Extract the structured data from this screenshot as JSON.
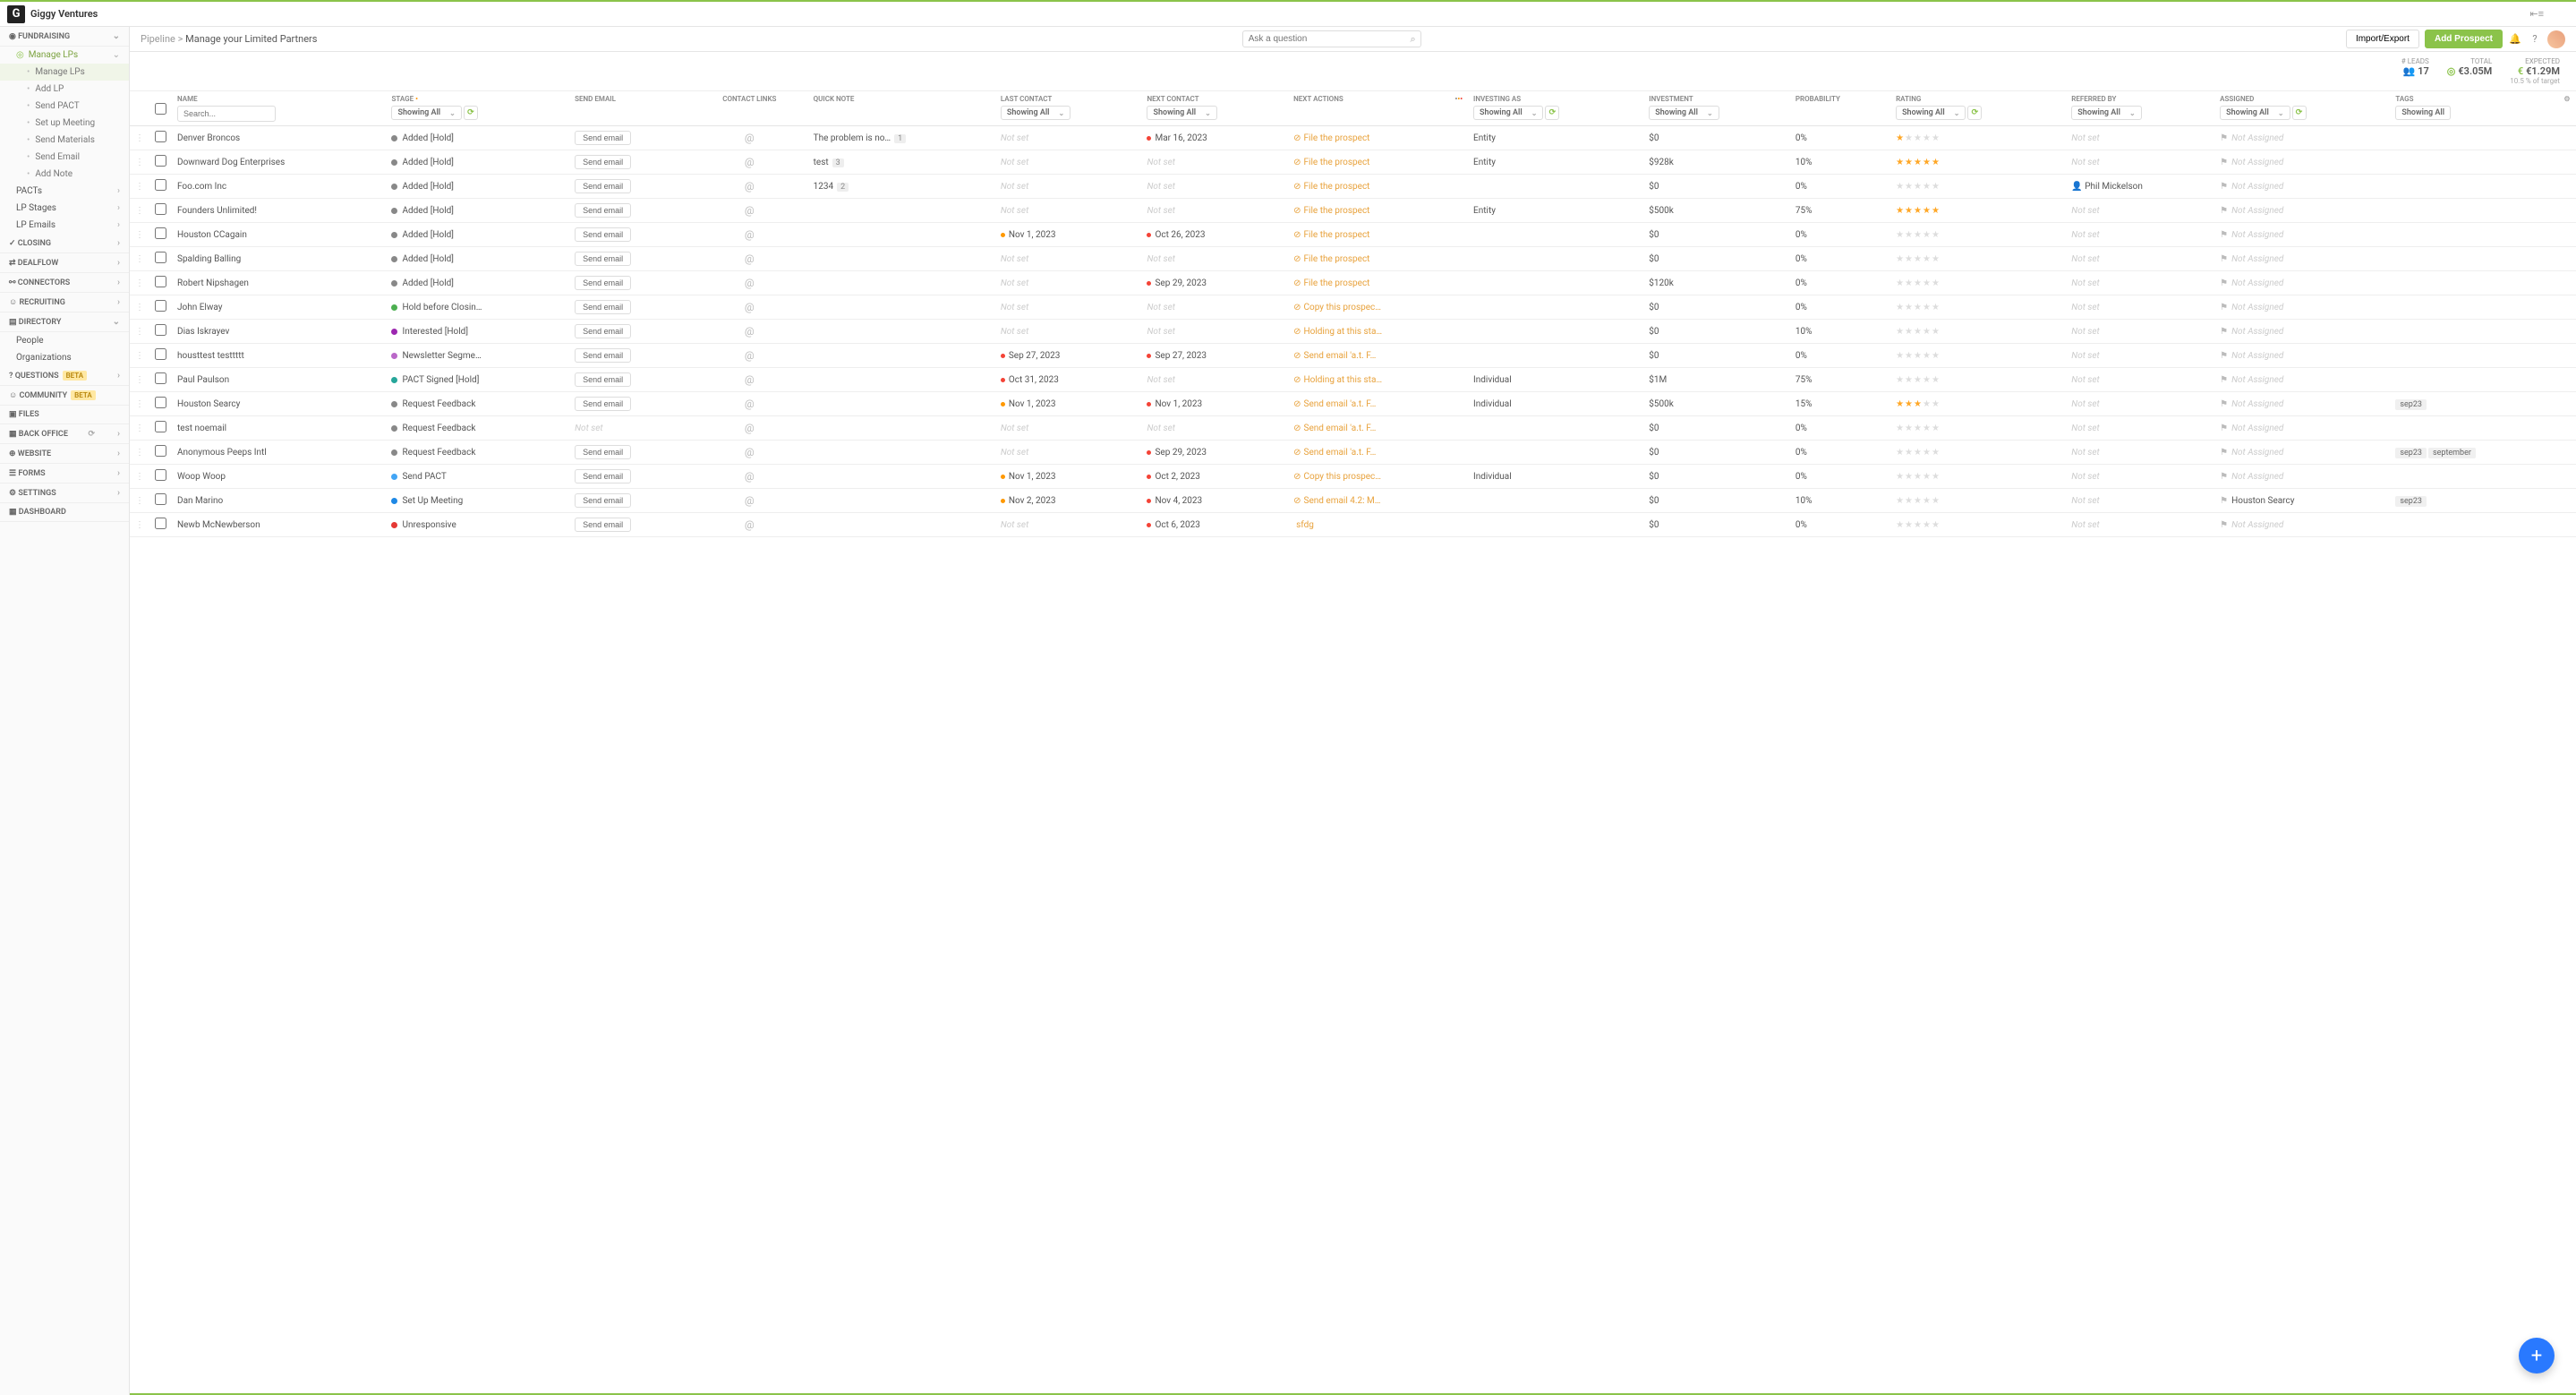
{
  "org": "Giggy Ventures",
  "breadcrumb": {
    "root": "Pipeline",
    "current": "Manage your Limited Partners"
  },
  "search": {
    "placeholder": "Ask a question"
  },
  "top_buttons": {
    "import_export": "Import/Export",
    "add_prospect": "Add Prospect"
  },
  "stats": {
    "leads": {
      "label": "# LEADS",
      "value": "17"
    },
    "total": {
      "label": "TOTAL",
      "value": "€3.05M"
    },
    "expected": {
      "label": "EXPECTED",
      "value": "€1.29M",
      "sub": "10.5 % of target"
    }
  },
  "sidebar": {
    "fundraising": {
      "label": "FUNDRAISING",
      "manage_lps": "Manage LPs",
      "items": [
        {
          "label": "Manage LPs",
          "active": true
        },
        {
          "label": "Add LP"
        },
        {
          "label": "Send PACT"
        },
        {
          "label": "Set up Meeting"
        },
        {
          "label": "Send Materials"
        },
        {
          "label": "Send Email"
        },
        {
          "label": "Add Note"
        }
      ],
      "pacts": "PACTs",
      "lp_stages": "LP Stages",
      "lp_emails": "LP Emails"
    },
    "closing": "CLOSING",
    "dealflow": "DEALFLOW",
    "connectors": "CONNECTORS",
    "recruiting": "RECRUITING",
    "directory": {
      "label": "DIRECTORY",
      "people": "People",
      "organizations": "Organizations"
    },
    "questions": "QUESTIONS",
    "community": "COMMUNITY",
    "files": "FILES",
    "back_office": "BACK OFFICE",
    "website": "WEBSITE",
    "forms": "FORMS",
    "settings": "SETTINGS",
    "dashboard": "DASHBOARD",
    "beta": "BETA"
  },
  "columns": {
    "name": "NAME",
    "stage": "STAGE",
    "send_email": "SEND EMAIL",
    "contact_links": "CONTACT LINKS",
    "quick_note": "QUICK NOTE",
    "last_contact": "LAST CONTACT",
    "next_contact": "NEXT CONTACT",
    "next_actions": "NEXT ACTIONS",
    "investing_as": "INVESTING AS",
    "investment": "INVESTMENT",
    "probability": "PROBABILITY",
    "rating": "RATING",
    "referred_by": "REFERRED BY",
    "assigned": "ASSIGNED",
    "tags": "TAGS",
    "showing_all": "Showing All",
    "search_placeholder": "Search..."
  },
  "common": {
    "send_email": "Send email",
    "not_set": "Not set",
    "not_assigned": "Not Assigned"
  },
  "rows": [
    {
      "name": "Denver Broncos",
      "stage": "Added [Hold]",
      "stage_color": "dot-grey",
      "note": "The problem is no…",
      "note_count": "1",
      "last": null,
      "next": "Mar 16, 2023",
      "next_color": "date-red",
      "action": "File the prospect",
      "action_ic": "⊘",
      "inv_as": "Entity",
      "inv": "$0",
      "prob": "0%",
      "stars": 1,
      "ref": null,
      "assigned": null,
      "tags": []
    },
    {
      "name": "Downward Dog Enterprises",
      "stage": "Added [Hold]",
      "stage_color": "dot-grey",
      "note": "test",
      "note_count": "3",
      "last": null,
      "next": null,
      "action": "File the prospect",
      "action_ic": "⊘",
      "inv_as": "Entity",
      "inv": "$928k",
      "prob": "10%",
      "stars": 5,
      "ref": null,
      "assigned": null,
      "tags": []
    },
    {
      "name": "Foo.com Inc",
      "stage": "Added [Hold]",
      "stage_color": "dot-grey",
      "note": "1234",
      "note_count": "2",
      "last": null,
      "next": null,
      "action": "File the prospect",
      "action_ic": "⊘",
      "inv_as": null,
      "inv": "$0",
      "prob": "0%",
      "stars": 0,
      "ref": "Phil Mickelson",
      "assigned": null,
      "tags": []
    },
    {
      "name": "Founders Unlimited!",
      "stage": "Added [Hold]",
      "stage_color": "dot-grey",
      "note": null,
      "last": null,
      "next": null,
      "action": "File the prospect",
      "action_ic": "⊘",
      "inv_as": "Entity",
      "inv": "$500k",
      "prob": "75%",
      "stars": 5,
      "ref": null,
      "assigned": null,
      "tags": []
    },
    {
      "name": "Houston CCagain",
      "stage": "Added [Hold]",
      "stage_color": "dot-grey",
      "note": null,
      "last": "Nov 1, 2023",
      "last_color": "date-orange",
      "next": "Oct 26, 2023",
      "next_color": "date-red",
      "action": "File the prospect",
      "action_ic": "⊘",
      "inv_as": null,
      "inv": "$0",
      "prob": "0%",
      "stars": 0,
      "ref": null,
      "assigned": null,
      "tags": []
    },
    {
      "name": "Spalding Balling",
      "stage": "Added [Hold]",
      "stage_color": "dot-grey",
      "note": null,
      "last": null,
      "next": null,
      "action": "File the prospect",
      "action_ic": "⊘",
      "inv_as": null,
      "inv": "$0",
      "prob": "0%",
      "stars": 0,
      "ref": null,
      "assigned": null,
      "tags": []
    },
    {
      "name": "Robert Nipshagen",
      "stage": "Added [Hold]",
      "stage_color": "dot-grey",
      "note": null,
      "last": null,
      "next": "Sep 29, 2023",
      "next_color": "date-red",
      "action": "File the prospect",
      "action_ic": "⊘",
      "inv_as": null,
      "inv": "$120k",
      "prob": "0%",
      "stars": 0,
      "ref": null,
      "assigned": null,
      "tags": []
    },
    {
      "name": "John Elway",
      "stage": "Hold before Closin…",
      "stage_color": "dot-green",
      "note": null,
      "last": null,
      "next": null,
      "action": "Copy this prospec…",
      "action_ic": "⊘",
      "inv_as": null,
      "inv": "$0",
      "prob": "0%",
      "stars": 0,
      "ref": null,
      "assigned": null,
      "tags": []
    },
    {
      "name": "Dias Iskrayev",
      "stage": "Interested [Hold]",
      "stage_color": "dot-purple",
      "note": null,
      "last": null,
      "next": null,
      "action": "Holding at this sta…",
      "action_ic": "⊘",
      "inv_as": null,
      "inv": "$0",
      "prob": "10%",
      "stars": 0,
      "ref": null,
      "assigned": null,
      "tags": []
    },
    {
      "name": "housttest testtttt",
      "stage": "Newsletter Segme…",
      "stage_color": "dot-purple-light",
      "note": null,
      "last": "Sep 27, 2023",
      "last_color": "date-red",
      "next": "Sep 27, 2023",
      "next_color": "date-red",
      "action": "Send email 'a.t. F…",
      "action_ic": "⊘",
      "inv_as": null,
      "inv": "$0",
      "prob": "0%",
      "stars": 0,
      "ref": null,
      "assigned": null,
      "tags": []
    },
    {
      "name": "Paul Paulson",
      "stage": "PACT Signed [Hold]",
      "stage_color": "dot-teal",
      "note": null,
      "last": "Oct 31, 2023",
      "last_color": "date-red",
      "next": null,
      "action": "Holding at this sta…",
      "action_ic": "⊘",
      "inv_as": "Individual",
      "inv": "$1M",
      "prob": "75%",
      "stars": 0,
      "ref": null,
      "assigned": null,
      "tags": []
    },
    {
      "name": "Houston Searcy",
      "stage": "Request Feedback",
      "stage_color": "dot-grey",
      "note": null,
      "last": "Nov 1, 2023",
      "last_color": "date-orange",
      "next": "Nov 1, 2023",
      "next_color": "date-red",
      "action": "Send email 'a.t. F…",
      "action_ic": "⊘",
      "inv_as": "Individual",
      "inv": "$500k",
      "prob": "15%",
      "stars": 3,
      "ref": null,
      "assigned": null,
      "tags": [
        "sep23"
      ]
    },
    {
      "name": "test noemail",
      "stage": "Request Feedback",
      "stage_color": "dot-grey",
      "no_send": true,
      "note": null,
      "last": null,
      "next": null,
      "action": "Send email 'a.t. F…",
      "action_ic": "⊘",
      "inv_as": null,
      "inv": "$0",
      "prob": "0%",
      "stars": 0,
      "ref": null,
      "assigned": null,
      "tags": []
    },
    {
      "name": "Anonymous Peeps Intl",
      "stage": "Request Feedback",
      "stage_color": "dot-grey",
      "note": null,
      "last": null,
      "next": "Sep 29, 2023",
      "next_color": "date-red",
      "action": "Send email 'a.t. F…",
      "action_ic": "⊘",
      "inv_as": null,
      "inv": "$0",
      "prob": "0%",
      "stars": 0,
      "ref": null,
      "assigned": null,
      "tags": [
        "sep23",
        "september"
      ]
    },
    {
      "name": "Woop Woop",
      "stage": "Send PACT",
      "stage_color": "dot-blue",
      "note": null,
      "last": "Nov 1, 2023",
      "last_color": "date-orange",
      "next": "Oct 2, 2023",
      "next_color": "date-red",
      "action": "Copy this prospec…",
      "action_ic": "⊘",
      "inv_as": "Individual",
      "inv": "$0",
      "prob": "0%",
      "stars": 0,
      "ref": null,
      "assigned": null,
      "tags": []
    },
    {
      "name": "Dan Marino",
      "stage": "Set Up Meeting",
      "stage_color": "dot-darkblue",
      "note": null,
      "last": "Nov 2, 2023",
      "last_color": "date-orange",
      "next": "Nov 4, 2023",
      "next_color": "date-red",
      "action": "Send email 4.2: M…",
      "action_ic": "⊘",
      "inv_as": null,
      "inv": "$0",
      "prob": "10%",
      "stars": 0,
      "ref": null,
      "assigned": "Houston Searcy",
      "tags": [
        "sep23"
      ]
    },
    {
      "name": "Newb McNewberson",
      "stage": "Unresponsive",
      "stage_color": "dot-red",
      "note": null,
      "last": null,
      "next": "Oct 6, 2023",
      "next_color": "date-red",
      "action": "sfdg",
      "action_ic": "",
      "inv_as": null,
      "inv": "$0",
      "prob": "0%",
      "stars": 0,
      "ref": null,
      "assigned": null,
      "tags": []
    }
  ]
}
